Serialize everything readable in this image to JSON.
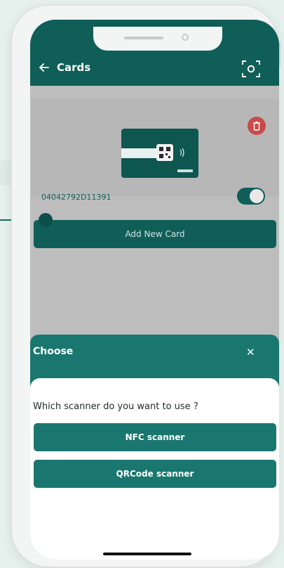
{
  "header": {
    "title": "Cards",
    "back_icon": "arrow-left-icon",
    "scan_icon": "scan-frame-icon"
  },
  "card": {
    "number": "04042792D11391",
    "enabled": true,
    "delete_icon": "trash-icon"
  },
  "actions": {
    "add_new_card": "Add New Card"
  },
  "sheet": {
    "title": "Choose",
    "close_icon": "close-icon",
    "question": "Which scanner do you want to use ?",
    "options": [
      "NFC scanner",
      "QRCode scanner"
    ]
  },
  "colors": {
    "primary": "#0f5f58",
    "sheet": "#1a7770",
    "danger": "#c94a4a",
    "overlay": "#bdbdbd"
  }
}
